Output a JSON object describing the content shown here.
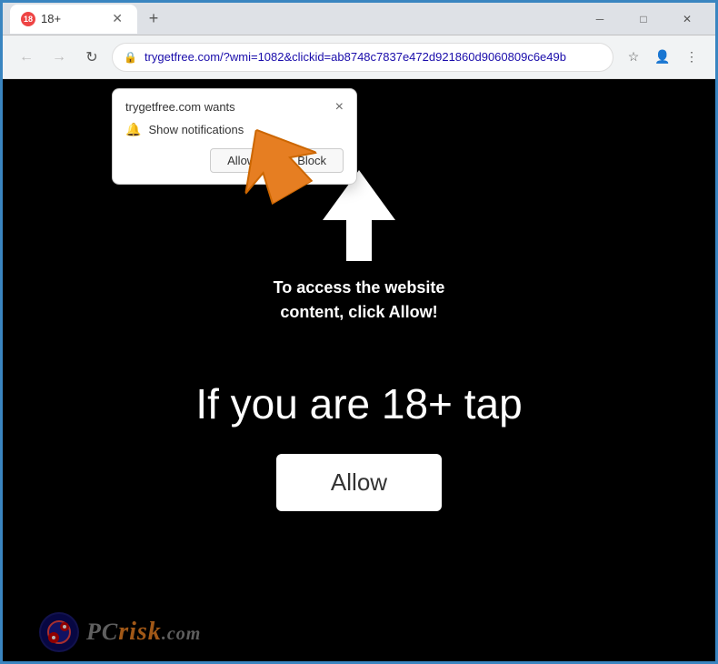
{
  "window": {
    "title": "18+",
    "close_label": "✕",
    "minimize_label": "─",
    "maximize_label": "□"
  },
  "tabs": [
    {
      "label": "18+",
      "active": true
    }
  ],
  "new_tab_label": "+",
  "address_bar": {
    "url": "trygetfree.com/?wmi=1082&clickid=ab8748c7837e472d921860d9060809c6e49b",
    "lock_icon": "🔒"
  },
  "nav": {
    "back": "←",
    "forward": "→",
    "refresh": "↻"
  },
  "notification_popup": {
    "title": "trygetfree.com wants",
    "close_label": "×",
    "notification_text": "Show notifications",
    "allow_label": "Allow",
    "block_label": "Block"
  },
  "page": {
    "instruction_text": "To access the website\ncontent, click Allow!",
    "big_text": "If you are 18+ tap",
    "allow_button_label": "Allow"
  },
  "watermark": {
    "text_pc": "PC",
    "text_risk": "risk",
    "text_com": ".com"
  },
  "colors": {
    "orange_arrow": "#e67e22",
    "page_bg": "#000000",
    "browser_border": "#2a6496"
  }
}
